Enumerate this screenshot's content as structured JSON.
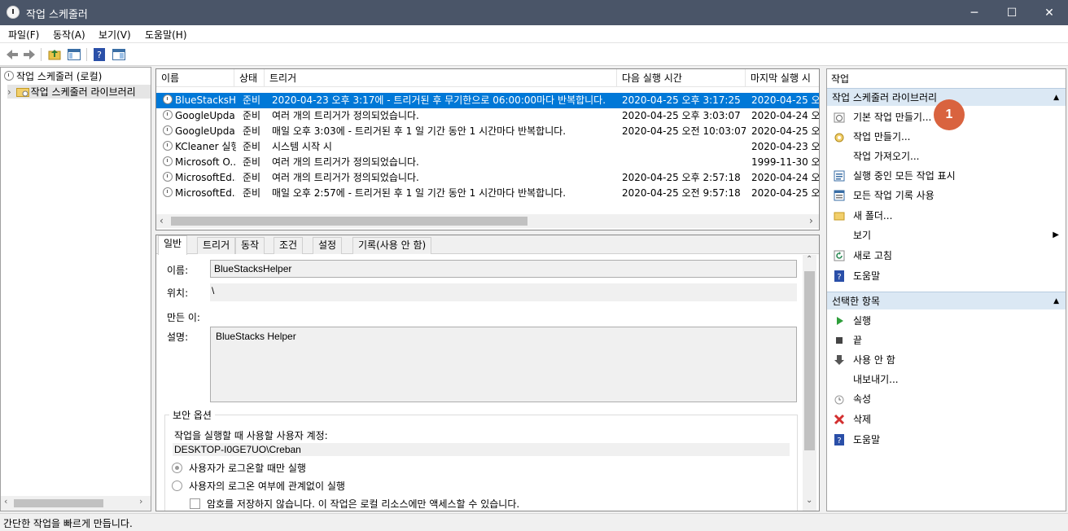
{
  "window": {
    "title": "작업 스케줄러",
    "min_icon": "─",
    "max_icon": "☐",
    "close_icon": "✕"
  },
  "menu": [
    "파일(F)",
    "동작(A)",
    "보기(V)",
    "도움말(H)"
  ],
  "tree": {
    "root": "작업 스케줄러 (로컬)",
    "child": "작업 스케줄러 라이브러리"
  },
  "tasklist": {
    "columns": [
      "이름",
      "상태",
      "트리거",
      "다음 실행 시간",
      "마지막 실행 시"
    ],
    "rows": [
      {
        "name": "BlueStacksH...",
        "status": "준비",
        "trigger": "2020-04-23 오후 3:17에 - 트리거된 후 무기한으로 06:00:00마다 반복합니다.",
        "next": "2020-04-25 오후 3:17:25",
        "last": "2020-04-25 오"
      },
      {
        "name": "GoogleUpda...",
        "status": "준비",
        "trigger": "여러 개의 트리거가 정의되었습니다.",
        "next": "2020-04-25 오후 3:03:07",
        "last": "2020-04-24 오"
      },
      {
        "name": "GoogleUpda...",
        "status": "준비",
        "trigger": "매일 오후 3:03에 - 트리거된 후 1 일 기간 동안 1 시간마다 반복합니다.",
        "next": "2020-04-25 오전 10:03:07",
        "last": "2020-04-25 오"
      },
      {
        "name": "KCleaner 실행",
        "status": "준비",
        "trigger": "시스템 시작 시",
        "next": "",
        "last": "2020-04-23 오"
      },
      {
        "name": "Microsoft O...",
        "status": "준비",
        "trigger": "여러 개의 트리거가 정의되었습니다.",
        "next": "",
        "last": "1999-11-30 오"
      },
      {
        "name": "MicrosoftEd...",
        "status": "준비",
        "trigger": "여러 개의 트리거가 정의되었습니다.",
        "next": "2020-04-25 오후 2:57:18",
        "last": "2020-04-24 오"
      },
      {
        "name": "MicrosoftEd...",
        "status": "준비",
        "trigger": "매일 오후 2:57에 - 트리거된 후 1 일 기간 동안 1 시간마다 반복합니다.",
        "next": "2020-04-25 오전 9:57:18",
        "last": "2020-04-25 오"
      }
    ]
  },
  "details": {
    "tabs": [
      "일반",
      "트리거",
      "동작",
      "조건",
      "설정",
      "기록(사용 안 함)"
    ],
    "name_label": "이름:",
    "name_value": "BlueStacksHelper",
    "location_label": "위치:",
    "location_value": "\\",
    "author_label": "만든 이:",
    "desc_label": "설명:",
    "desc_value": "BlueStacks Helper",
    "security_title": "보안 옵션",
    "account_label": "작업을 실행할 때 사용할 사용자 계정:",
    "account_value": "DESKTOP-I0GE7UO\\Creban",
    "radio1": "사용자가 로그온할 때만 실행",
    "radio2": "사용자의 로그온 여부에 관계없이 실행",
    "checkbox1": "암호를 저장하지 않습니다. 이 작업은 로컬 리소스에만 액세스할 수 있습니다."
  },
  "actions": {
    "header": "작업",
    "group1": "작업 스케줄러 라이브러리",
    "items1": [
      "기본 작업 만들기...",
      "작업 만들기...",
      "작업 가져오기...",
      "실행 중인 모든 작업 표시",
      "모든 작업 기록 사용",
      "새 폴더...",
      "보기",
      "새로 고침",
      "도움말"
    ],
    "group2": "선택한 항목",
    "items2": [
      "실행",
      "끝",
      "사용 안 함",
      "내보내기...",
      "속성",
      "삭제",
      "도움말"
    ],
    "badge": "1"
  },
  "status": "간단한 작업을 빠르게 만듭니다."
}
